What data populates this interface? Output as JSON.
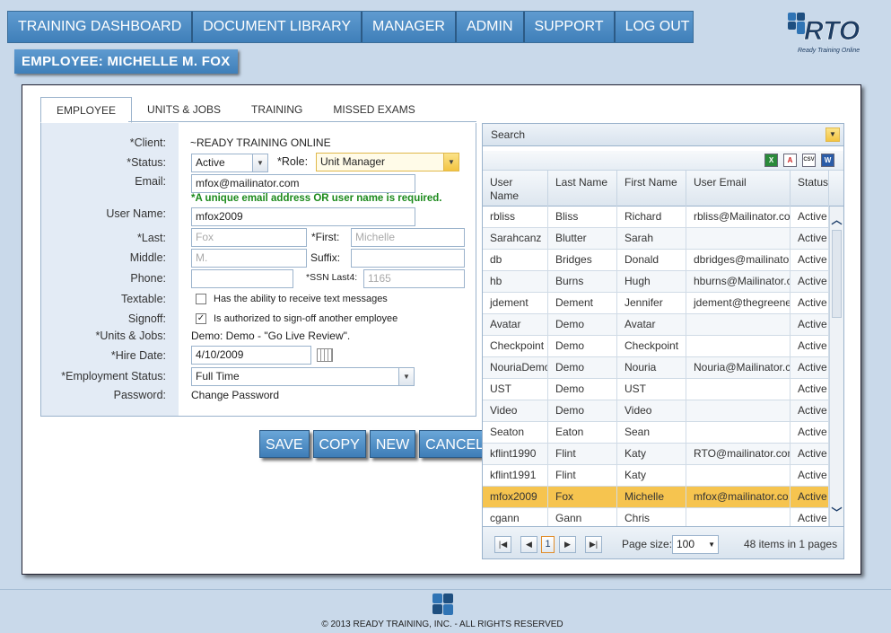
{
  "nav": {
    "items": [
      "TRAINING DASHBOARD",
      "DOCUMENT LIBRARY",
      "MANAGER",
      "ADMIN",
      "SUPPORT",
      "LOG OUT"
    ]
  },
  "logo": {
    "text": "RTO",
    "tagline": "Ready Training Online"
  },
  "banner": "EMPLOYEE: MICHELLE M. FOX",
  "tabs": [
    "EMPLOYEE",
    "UNITS & JOBS",
    "TRAINING",
    "MISSED EXAMS"
  ],
  "form": {
    "client_label": "*Client:",
    "client_value": "~READY TRAINING ONLINE",
    "status_label": "*Status:",
    "status_value": "Active",
    "role_label": "*Role:",
    "role_value": "Unit Manager",
    "email_label": "Email:",
    "email_value": "mfox@mailinator.com",
    "email_note": "*A unique email address OR user name is required.",
    "username_label": "User Name:",
    "username_value": "mfox2009",
    "last_label": "*Last:",
    "last_value": "Fox",
    "first_label": "*First:",
    "first_value": "Michelle",
    "middle_label": "Middle:",
    "middle_value": "M.",
    "suffix_label": "Suffix:",
    "suffix_value": "",
    "phone_label": "Phone:",
    "phone_value": "",
    "ssn_label": "*SSN Last4:",
    "ssn_value": "1165",
    "textable_label": "Textable:",
    "textable_text": "Has the ability to receive text messages",
    "textable_checked": false,
    "signoff_label": "Signoff:",
    "signoff_text": "Is authorized to sign-off another employee",
    "signoff_checked": true,
    "units_label": "*Units & Jobs:",
    "units_value": "Demo: Demo - \"Go Live Review\".",
    "hire_label": "*Hire Date:",
    "hire_value": "4/10/2009",
    "employment_label": "*Employment Status:",
    "employment_value": "Full Time",
    "password_label": "Password:",
    "password_link": "Change Password"
  },
  "buttons": {
    "save": "SAVE",
    "copy": "COPY",
    "new": "NEW",
    "cancel": "CANCEL"
  },
  "grid": {
    "search_label": "Search",
    "export_icons": [
      "excel-icon",
      "pdf-icon",
      "csv-icon",
      "word-icon"
    ],
    "headers": [
      "User Name",
      "Last Name",
      "First Name",
      "User Email",
      "Status"
    ],
    "rows": [
      [
        "rbliss",
        "Bliss",
        "Richard",
        "rbliss@Mailinator.co",
        "Active"
      ],
      [
        "Sarahcanz",
        "Blutter",
        "Sarah",
        "",
        "Active"
      ],
      [
        "db",
        "Bridges",
        "Donald",
        "dbridges@mailinato",
        "Active"
      ],
      [
        "hb",
        "Burns",
        "Hugh",
        "hburns@Mailinator.c",
        "Active"
      ],
      [
        "jdement",
        "Dement",
        "Jennifer",
        "jdement@thegreene",
        "Active"
      ],
      [
        "Avatar",
        "Demo",
        "Avatar",
        "",
        "Active"
      ],
      [
        "Checkpoint",
        "Demo",
        "Checkpoint",
        "",
        "Active"
      ],
      [
        "NouriaDemo",
        "Demo",
        "Nouria",
        "Nouria@Mailinator.c",
        "Active"
      ],
      [
        "UST",
        "Demo",
        "UST",
        "",
        "Active"
      ],
      [
        "Video",
        "Demo",
        "Video",
        "",
        "Active"
      ],
      [
        "Seaton",
        "Eaton",
        "Sean",
        "",
        "Active"
      ],
      [
        "kflint1990",
        "Flint",
        "Katy",
        "RTO@mailinator.com",
        "Active"
      ],
      [
        "kflint1991",
        "Flint",
        "Katy",
        "",
        "Active"
      ],
      [
        "mfox2009",
        "Fox",
        "Michelle",
        "mfox@mailinator.co",
        "Active"
      ],
      [
        "cgann",
        "Gann",
        "Chris",
        "",
        "Active"
      ]
    ],
    "selected_index": 13,
    "pager": {
      "current_page": "1",
      "page_size_label": "Page size:",
      "page_size": "100",
      "summary": "48 items in 1 pages"
    }
  },
  "footer": "© 2013 READY TRAINING, INC. - ALL RIGHTS RESERVED",
  "colors": {
    "accent": "#4a8bc4",
    "selected_row": "#f6c44f",
    "background": "#c9d9ea",
    "note_green": "#1c8a1c"
  }
}
